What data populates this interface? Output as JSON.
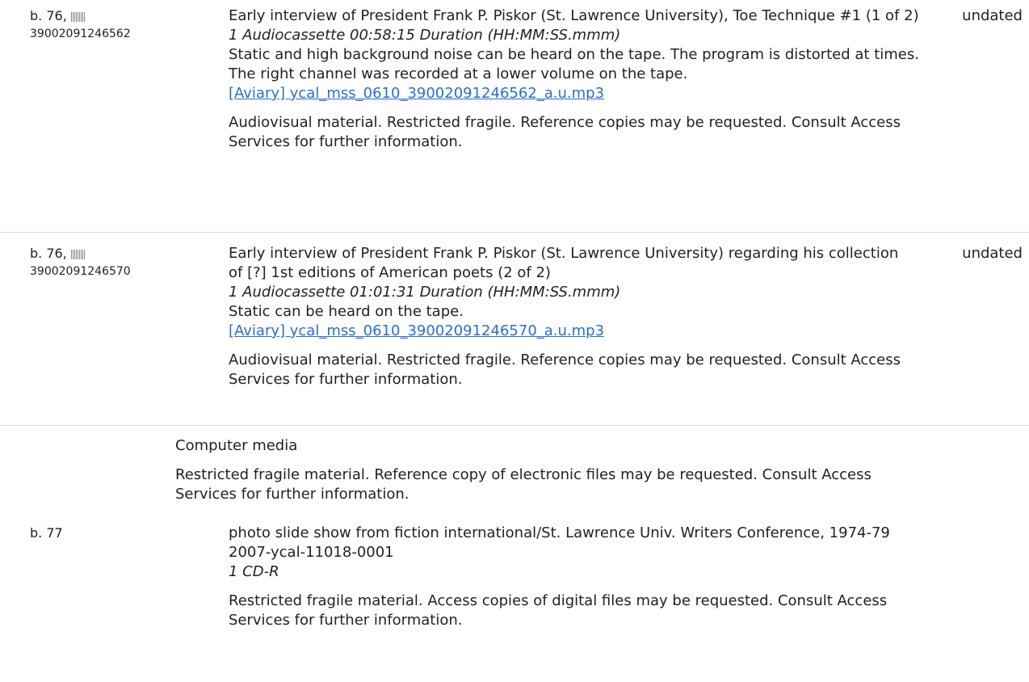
{
  "items": [
    {
      "box": "b. 76,",
      "barcode": "39002091246562",
      "title": "Early interview of President Frank P. Piskor (St. Lawrence University), Toe Technique #1 (1 of 2)",
      "extent": "1 Audiocassette  00:58:15 Duration (HH:MM:SS.mmm)",
      "note": "Static and high background noise can be heard on the tape. The program is distorted at times. The right channel was recorded at a lower volume on the tape.",
      "link": "[Aviary] ycal_mss_0610_39002091246562_a.u.mp3",
      "access": "Audiovisual material. Restricted fragile. Reference copies may be requested. Consult Access Services for further information.",
      "date": "undated"
    },
    {
      "box": "b. 76,",
      "barcode": "39002091246570",
      "title": "Early interview of President Frank P. Piskor (St. Lawrence University) regarding his collection of [?] 1st editions of American poets (2 of 2)",
      "extent": "1 Audiocassette  01:01:31 Duration (HH:MM:SS.mmm)",
      "note": "Static can be heard on the tape.",
      "link": "[Aviary] ycal_mss_0610_39002091246570_a.u.mp3",
      "access": "Audiovisual material. Restricted fragile. Reference copies may be requested. Consult Access Services for further information.",
      "date": "undated"
    }
  ],
  "series": {
    "heading": "Computer media",
    "access": "Restricted fragile material. Reference copy of electronic files may be requested. Consult Access Services for further information."
  },
  "item3": {
    "box": "b. 77",
    "title": "photo slide show from fiction international/St. Lawrence Univ. Writers Conference, 1974-79",
    "identifier": "2007-ycal-11018-0001",
    "extent": "1 CD-R",
    "access": "Restricted fragile material. Access copies of digital files may be requested. Consult Access Services for further information."
  }
}
